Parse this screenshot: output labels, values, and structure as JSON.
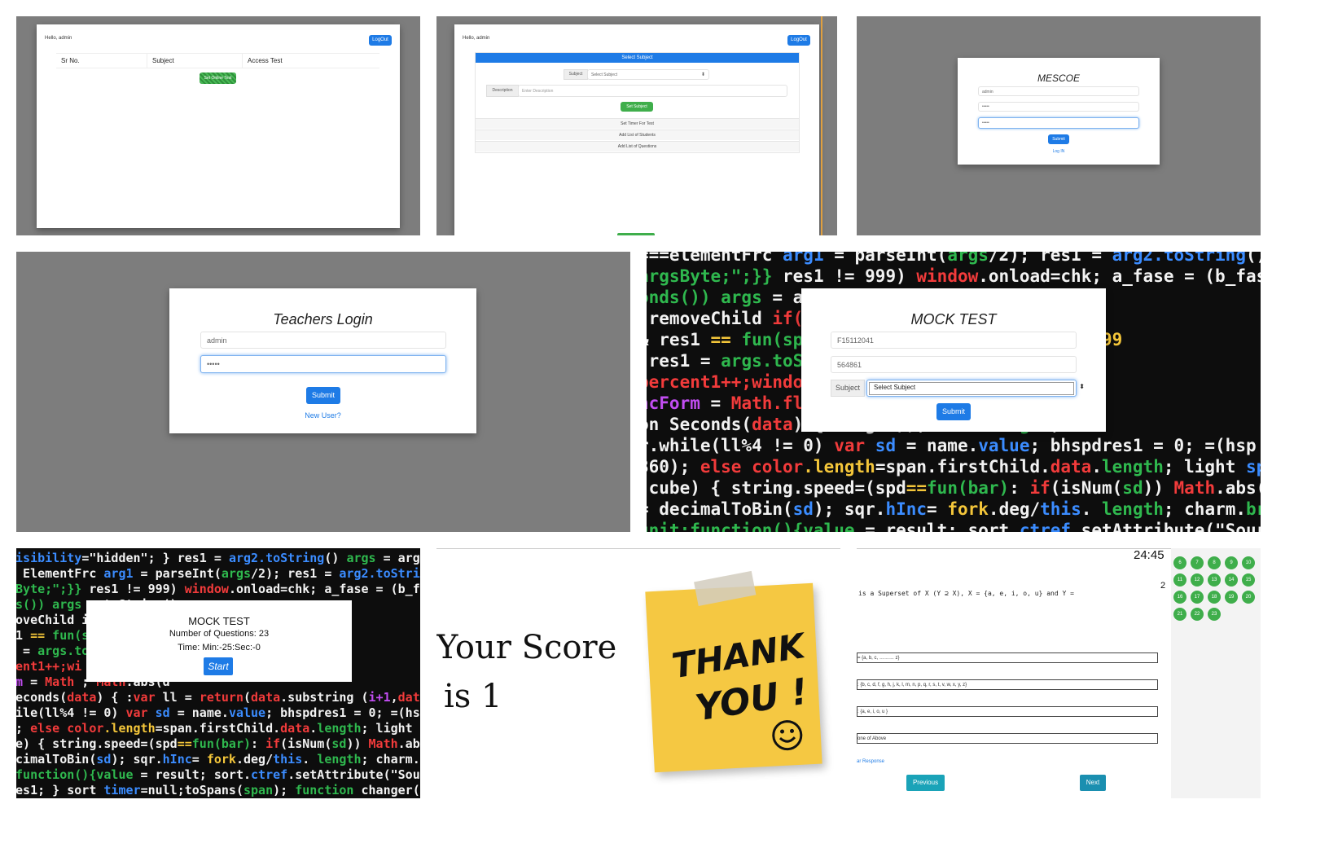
{
  "tile1": {
    "greeting": "Hello, admin",
    "logout_label": "LogOut",
    "columns": [
      "Sr No.",
      "Subject",
      "Access Test"
    ],
    "button_label": "Set Online Test"
  },
  "tile2": {
    "greeting": "Hello, admin",
    "logout_label": "LogOut",
    "header": "Select Subject",
    "subject_label": "Subject",
    "subject_value": "Select Subject",
    "description_label": "Description",
    "description_placeholder": "Enter Description",
    "set_subject_label": "Set Subject",
    "links": [
      "Set Timer For Test",
      "Add List of Students",
      "Add List of Questions"
    ]
  },
  "tile3": {
    "title": "MESCOE",
    "username": "admin",
    "password_mask": "•••••",
    "password2_mask": "•••••",
    "submit_label": "Submit",
    "login_link": "Log IN"
  },
  "tile4": {
    "title": "Teachers Login",
    "username": "admin",
    "password_mask": "•••••",
    "submit_label": "Submit",
    "new_user_link": "New User?"
  },
  "tile5": {
    "title": "MOCK TEST",
    "roll_number": "F15112041",
    "code": "564861",
    "subject_label": "Subject",
    "subject_value": "Select Subject",
    "submit_label": "Submit"
  },
  "tile6": {
    "title": "MOCK TEST",
    "questions_text": "Number of Questions: 23",
    "time_text": "Time: Min:-25:Sec:-0",
    "start_label": "Start"
  },
  "tile7": {
    "score_line1": "Your Score",
    "score_line2": "is 1",
    "note_line1": "THANK",
    "note_line2": "YOU !"
  },
  "tile8": {
    "timer": "24:45",
    "question_number": "2",
    "question_text": "is a Superset of X (Y ⊇ X), X = {a, e, i, o, u} and Y =",
    "options": [
      "= {a, b, c, ……… z}",
      ": {b, c, d, f, g, h, j, k, l, m, n, p, q, r, s, t, v, w, x, y, z}",
      ": {a, e, i, o, u }",
      "one of Above"
    ],
    "clear_link": "ar Response",
    "previous_label": "Previous",
    "next_label": "Next",
    "question_numbers": [
      "6",
      "7",
      "8",
      "9",
      "10",
      "11",
      "12",
      "13",
      "14",
      "15",
      "16",
      "17",
      "18",
      "19",
      "20",
      "21",
      "22",
      "23"
    ]
  },
  "colors": {
    "panel_gray": "#7d7d7d",
    "primary_blue": "#1e7be6",
    "green_button": "#3fae4b",
    "teal_button": "#1aa3b8",
    "palette_green": "#3fae4b",
    "sticky_yellow": "#f5c842"
  },
  "icons": [
    "smiley-icon",
    "tape-icon",
    "select-caret-icon"
  ]
}
